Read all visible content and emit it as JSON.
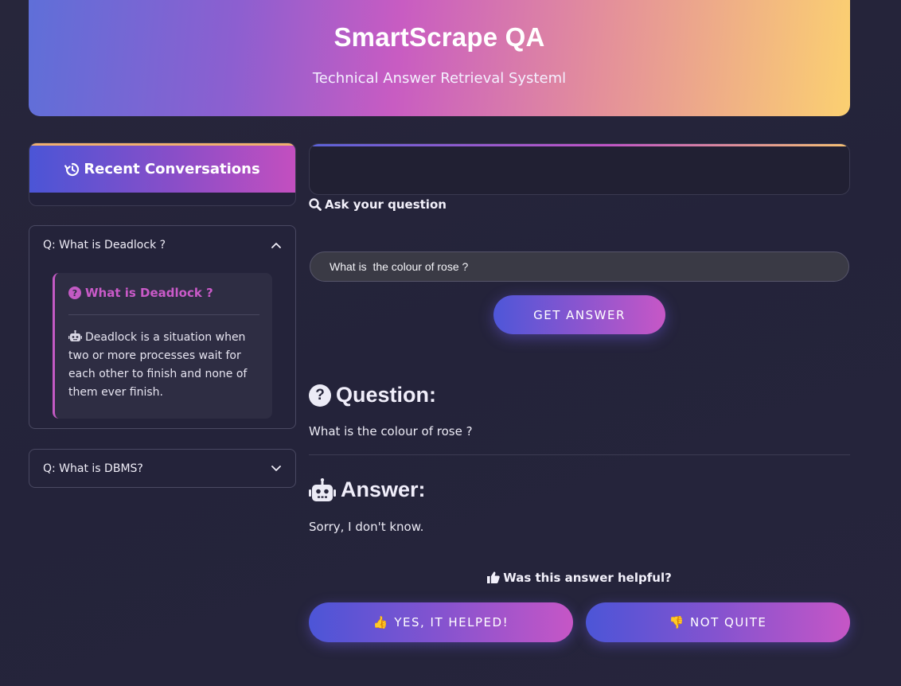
{
  "header": {
    "title": "SmartScrape QA",
    "subtitle": "Technical Answer Retrieval Systeml"
  },
  "sidebar": {
    "title": "Recent Conversations",
    "title_icon": "history-icon",
    "conversations": [
      {
        "label": "Q: What is Deadlock ?",
        "expanded": true,
        "question": "What is Deadlock ?",
        "answer": "Deadlock is a situation when two or more processes wait for each other to finish and none of them ever finish."
      },
      {
        "label": "Q: What is DBMS?",
        "expanded": false
      }
    ]
  },
  "main": {
    "ask_label": "Ask your question",
    "ask_icon": "search-icon",
    "question_value": "What is  the colour of rose ?",
    "get_answer_label": "GET ANSWER",
    "question_heading": "Question:",
    "question_text": "What is  the colour of rose ?",
    "answer_heading": "Answer:",
    "answer_text": "Sorry, I don't know.",
    "helpful_prompt": "Was this answer helpful?",
    "yes_label": "👍  YES, IT HELPED!",
    "no_label": "👎  NOT QUITE"
  },
  "colors": {
    "accent_pink": "#c35ac4",
    "accent_blue": "#4e56d8",
    "background": "#25243a"
  }
}
